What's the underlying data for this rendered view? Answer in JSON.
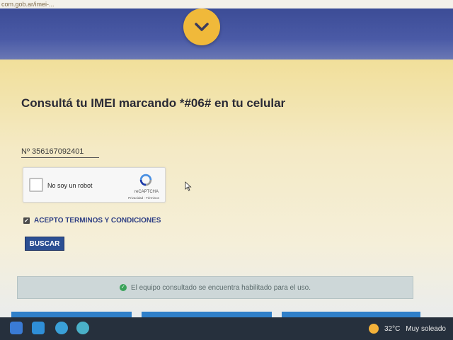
{
  "browser": {
    "url_fragment": "com.gob.ar/imei-..."
  },
  "header": {
    "chevron_icon": "chevron-down-icon",
    "chevron_color": "#f0b93a",
    "band_color": "#3c4c96"
  },
  "main": {
    "title": "Consultá tu IMEI marcando *#06# en tu celular",
    "imei_value": "Nº 356167092401"
  },
  "recaptcha": {
    "label": "No soy un robot",
    "brand": "reCAPTCHA",
    "links": "Privacidad - Términos"
  },
  "terms": {
    "checked": true,
    "label": "ACEPTO TERMINOS Y CONDICIONES"
  },
  "actions": {
    "search_label": "BUSCAR"
  },
  "alert": {
    "message": "El equipo consultado se encuentra habilitado para el uso.",
    "icon": "check-circle-icon"
  },
  "taskbar": {
    "temperature": "32°C",
    "weather": "Muy soleado"
  }
}
